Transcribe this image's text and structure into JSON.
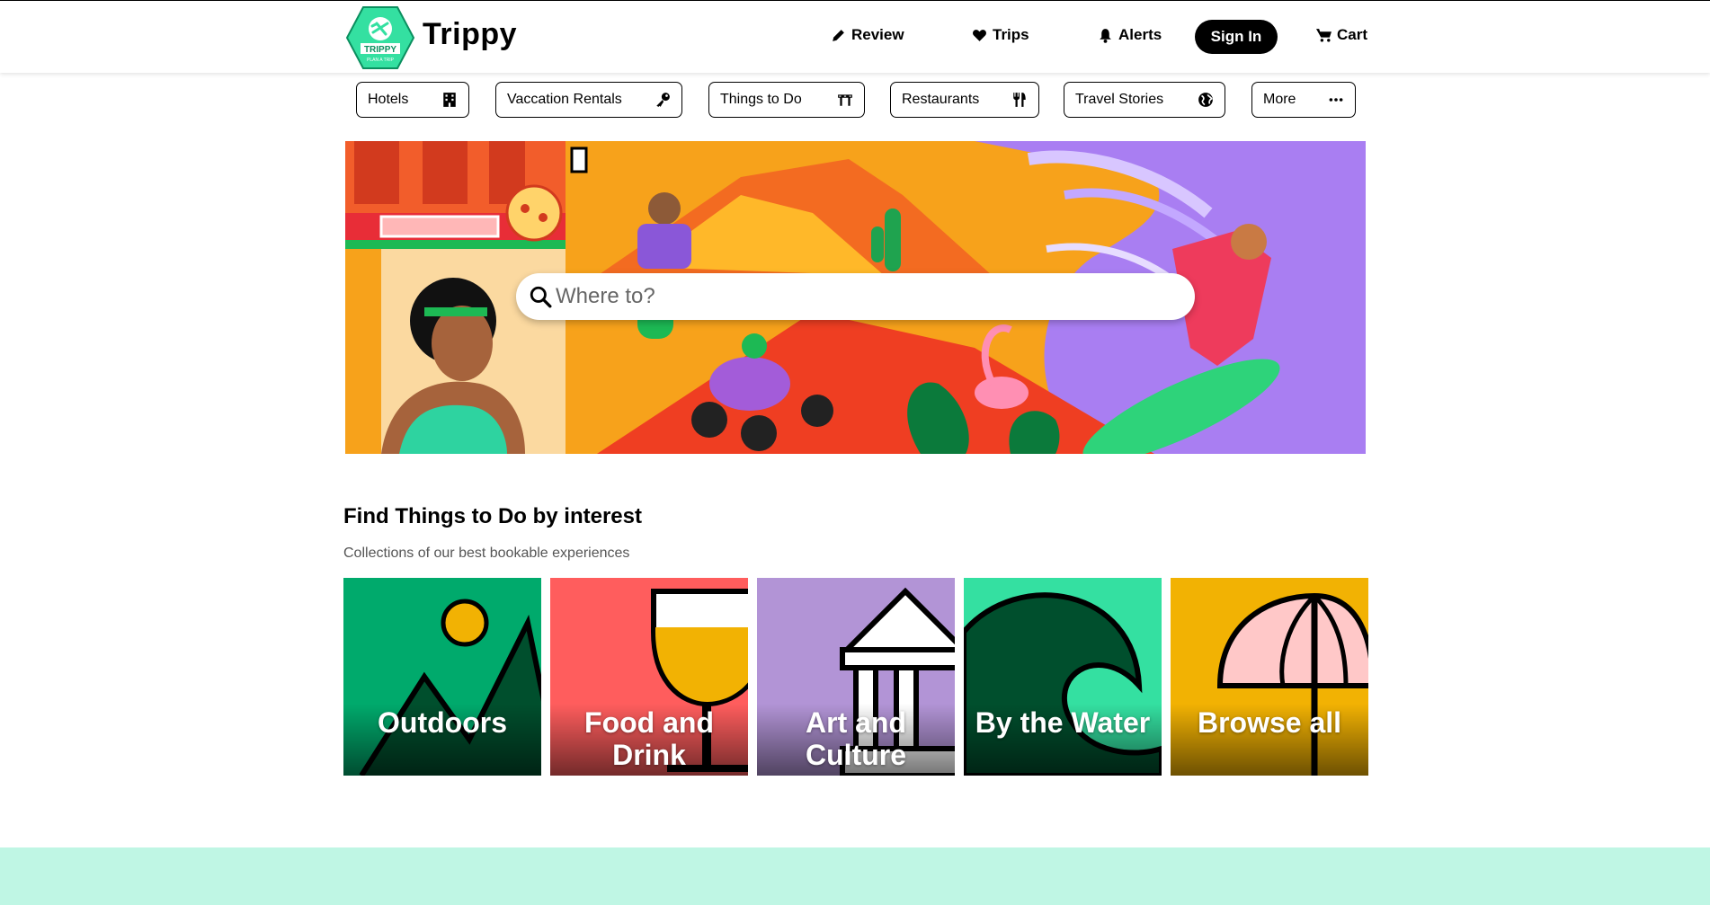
{
  "brand": {
    "name": "Trippy",
    "logo_text": "TRIPPY",
    "logo_sub": "PLAN A TRIP",
    "accent": "#34e0a1"
  },
  "nav": {
    "review": "Review",
    "trips": "Trips",
    "alerts": "Alerts",
    "signin": "Sign In",
    "cart": "Cart"
  },
  "categories": [
    {
      "label": "Hotels",
      "icon": "building-icon"
    },
    {
      "label": "Vaccation Rentals",
      "icon": "key-icon"
    },
    {
      "label": "Things to Do",
      "icon": "ticket-icon"
    },
    {
      "label": "Restaurants",
      "icon": "fork-knife-icon"
    },
    {
      "label": "Travel Stories",
      "icon": "globe-icon"
    },
    {
      "label": "More",
      "icon": "ellipsis-icon"
    }
  ],
  "search": {
    "placeholder": "Where to?"
  },
  "interest": {
    "title": "Find Things to Do by interest",
    "subtitle": "Collections of our best bookable experiences",
    "tiles": [
      {
        "label": "Outdoors",
        "color": "#00aa6c"
      },
      {
        "label": "Food and Drink",
        "color": "#ff5d5d"
      },
      {
        "label": "Art and Culture",
        "color": "#b294d6"
      },
      {
        "label": "By the Water",
        "color": "#34e0a1"
      },
      {
        "label": "Browse all",
        "color": "#f2b203"
      }
    ]
  }
}
